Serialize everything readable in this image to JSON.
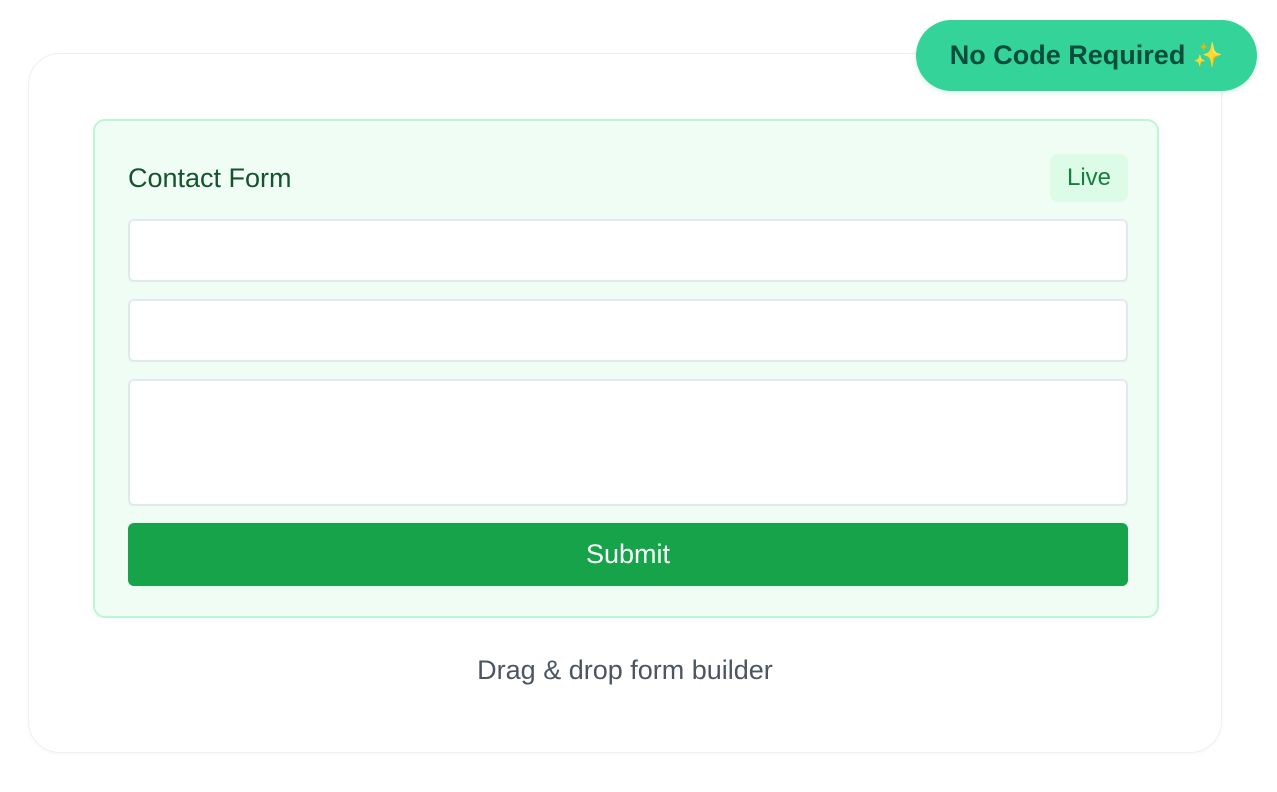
{
  "badge": {
    "label": "No Code Required",
    "icon": "sparkles",
    "icon_char": "✨",
    "color": "#34d399"
  },
  "form": {
    "title": "Contact Form",
    "status": "Live",
    "fields": [
      "",
      "",
      ""
    ],
    "submit_label": "Submit",
    "panel_color": "#f0fdf4",
    "accent_color": "#16a34a"
  },
  "caption": "Drag & drop form builder"
}
